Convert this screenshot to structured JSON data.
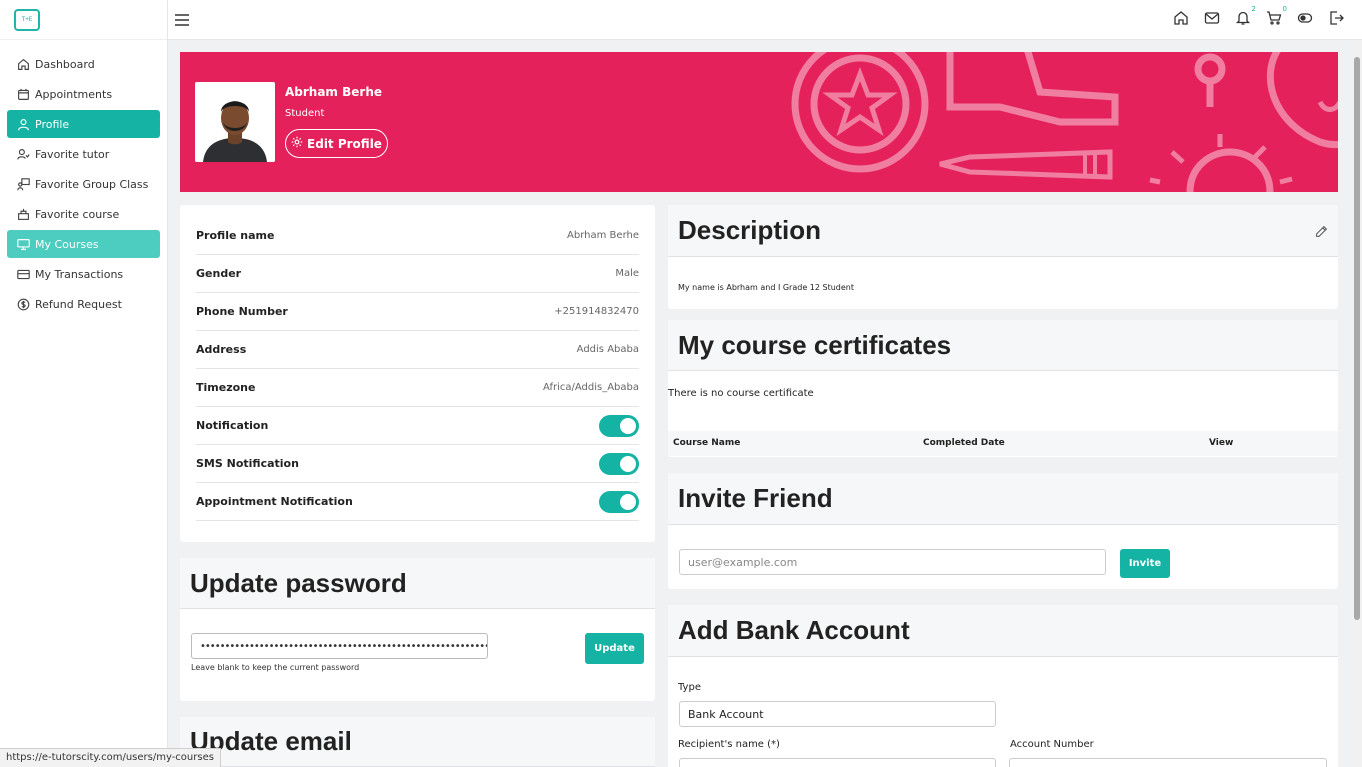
{
  "sidebar": {
    "logo_text": "T+E",
    "items": [
      {
        "label": "Dashboard",
        "icon": "home-icon"
      },
      {
        "label": "Appointments",
        "icon": "calendar-icon"
      },
      {
        "label": "Profile",
        "icon": "user-icon"
      },
      {
        "label": "Favorite tutor",
        "icon": "user-heart-icon"
      },
      {
        "label": "Favorite Group Class",
        "icon": "group-class-icon"
      },
      {
        "label": "Favorite course",
        "icon": "course-icon"
      },
      {
        "label": "My Courses",
        "icon": "monitor-icon"
      },
      {
        "label": "My Transactions",
        "icon": "card-icon"
      },
      {
        "label": "Refund Request",
        "icon": "dollar-icon"
      }
    ]
  },
  "topbar": {
    "notification_count": "2",
    "cart_count": "0"
  },
  "banner": {
    "name": "Abrham Berhe",
    "role": "Student",
    "edit_label": "Edit Profile",
    "color": "#e5215b"
  },
  "profile": {
    "rows": [
      {
        "label": "Profile name",
        "value": "Abrham Berhe"
      },
      {
        "label": "Gender",
        "value": "Male"
      },
      {
        "label": "Phone Number",
        "value": "+251914832470"
      },
      {
        "label": "Address",
        "value": "Addis Ababa"
      },
      {
        "label": "Timezone",
        "value": "Africa/Addis_Ababa"
      }
    ],
    "toggles": [
      {
        "label": "Notification",
        "on": true
      },
      {
        "label": "SMS Notification",
        "on": true
      },
      {
        "label": "Appointment Notification",
        "on": true
      }
    ]
  },
  "password": {
    "title": "Update password",
    "value": "••••••••••••••••••••••••••••••••••••••••••••••••••••••••••••••",
    "hint": "Leave blank to keep the current password",
    "button": "Update"
  },
  "email": {
    "title": "Update email"
  },
  "description": {
    "title": "Description",
    "text": "My name is Abrham and I Grade 12 Student"
  },
  "certificates": {
    "title": "My course certificates",
    "empty": "There is no course certificate",
    "columns": [
      "Course Name",
      "Completed Date",
      "View"
    ]
  },
  "invite": {
    "title": "Invite Friend",
    "placeholder": "user@example.com",
    "button": "Invite"
  },
  "bank": {
    "title": "Add Bank Account",
    "type_label": "Type",
    "type_value": "Bank Account",
    "recipient_label": "Recipient's name (*)",
    "account_label": "Account Number"
  },
  "status_url": "https://e-tutorscity.com/users/my-courses",
  "accent": "#14b3a4"
}
